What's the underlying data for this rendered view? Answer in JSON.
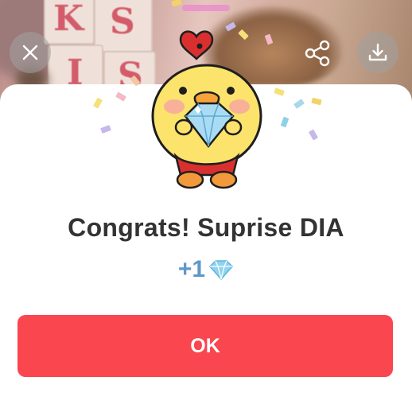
{
  "dialog": {
    "title": "Congrats! Suprise DIA",
    "reward_amount": "+1",
    "reward_icon": "diamond-icon",
    "ok_label": "OK"
  },
  "toolbar": {
    "close_icon": "close-icon",
    "share_icon": "share-icon",
    "download_icon": "download-icon"
  },
  "background": {
    "block_letters": [
      "K",
      "S",
      "I",
      "S"
    ]
  },
  "colors": {
    "accent": "#f9464f",
    "reward_text": "#5f98c7",
    "title_text": "#333333"
  }
}
